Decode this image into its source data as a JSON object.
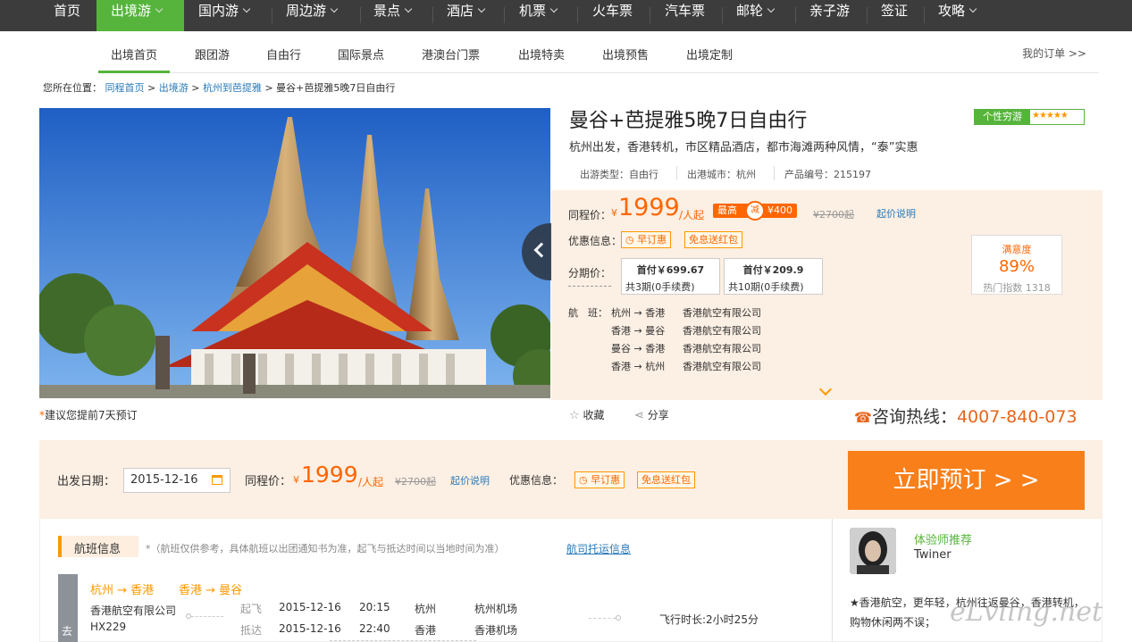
{
  "topnav": {
    "items": [
      {
        "label": "首页",
        "dropdown": false
      },
      {
        "label": "出境游",
        "dropdown": true
      },
      {
        "label": "国内游",
        "dropdown": true
      },
      {
        "label": "周边游",
        "dropdown": true
      },
      {
        "label": "景点",
        "dropdown": true
      },
      {
        "label": "酒店",
        "dropdown": true
      },
      {
        "label": "机票",
        "dropdown": true
      },
      {
        "label": "火车票",
        "dropdown": false
      },
      {
        "label": "汽车票",
        "dropdown": false
      },
      {
        "label": "邮轮",
        "dropdown": true
      },
      {
        "label": "亲子游",
        "dropdown": false
      },
      {
        "label": "签证",
        "dropdown": false
      },
      {
        "label": "攻略",
        "dropdown": true
      }
    ],
    "active": "出境游"
  },
  "subnav": {
    "items": [
      "出境首页",
      "跟团游",
      "自由行",
      "国际景点",
      "港澳台门票",
      "出境特卖",
      "出境预售",
      "出境定制"
    ],
    "my_order": "我的订单 >>"
  },
  "breadcrumb": {
    "prefix": "您所在位置：",
    "links": [
      "同程首页",
      "出境游",
      "杭州到芭提雅"
    ],
    "current": "曼谷+芭提雅5晚7日自由行",
    "sep": ">"
  },
  "advice": {
    "star": "*",
    "text": "建议您提前7天预订"
  },
  "product": {
    "title": "曼谷+芭提雅5晚7日自由行",
    "tag": "个性穷游",
    "stars": "★★★★★",
    "subtitle": "杭州出发，香港转机，市区精品酒店，都市海滩两种风情，“泰”实惠",
    "meta": [
      "出游类型：自由行",
      "出港城市：杭州",
      "产品编号：215197"
    ]
  },
  "pricebox": {
    "price_label": "同程价：",
    "currency": "¥",
    "price": "1999",
    "unit": "/人起",
    "max_label": "最高",
    "jian": "减",
    "max_value": "¥400",
    "original": "¥2700起",
    "explain": "起价说明",
    "promo_label": "优惠信息：",
    "promos": [
      "早订惠",
      "免息送红包"
    ],
    "installment_label": "分期价：",
    "installments": [
      {
        "first": "首付￥699.67",
        "detail": "共3期(0手续费)"
      },
      {
        "first": "首付￥209.9",
        "detail": "共10期(0手续费)"
      }
    ],
    "satisfaction": {
      "title": "满意度",
      "value": "89%",
      "hot": "热门指数 1318"
    },
    "flight_label": "航　班：",
    "flights": [
      {
        "route": "杭州 → 香港",
        "airline": "香港航空有限公司"
      },
      {
        "route": "香港 → 曼谷",
        "airline": "香港航空有限公司"
      },
      {
        "route": "曼谷 → 香港",
        "airline": "香港航空有限公司"
      },
      {
        "route": "香港 → 杭州",
        "airline": "香港航空有限公司"
      }
    ]
  },
  "actions": {
    "favorite": "收藏",
    "share": "分享"
  },
  "hotline": {
    "label": "咨询热线：",
    "number": "4007-840-073"
  },
  "bookbar": {
    "date_label": "出发日期：",
    "date": "2015-12-16",
    "price_label": "同程价：",
    "currency": "¥",
    "price": "1999",
    "unit": "/人起",
    "original": "¥2700起",
    "explain": "起价说明",
    "promo_label": "优惠信息：",
    "promos": [
      "早订惠",
      "免息送红包"
    ],
    "book_button": "立即预订 > >"
  },
  "flight_section": {
    "title": "航班信息",
    "note": "*（航班仅供参考，具体航班以出团通知书为准，起飞与抵达时间以当地时间为准）",
    "link": "航司托运信息",
    "direction": "去",
    "route1": "杭州 → 香港",
    "route2": "香港 → 曼谷",
    "airline": "香港航空有限公司",
    "flight_no": "HX229",
    "depart": {
      "label": "起飞",
      "date": "2015-12-16",
      "time": "20:15",
      "city": "杭州",
      "airport": "杭州机场"
    },
    "arrive": {
      "label": "抵达",
      "date": "2015-12-16",
      "time": "22:40",
      "city": "香港",
      "airport": "香港机场"
    },
    "duration": "飞行时长:2小时25分"
  },
  "recommend": {
    "title": "体验师推荐",
    "name": "Twiner",
    "text": "★香港航空，更年轻，杭州往返曼谷，香港转机，购物休闲两不误；"
  },
  "watermark": "eLvling.net",
  "colors": {
    "brand_green": "#56b43c",
    "accent_orange": "#f87f1a",
    "link_blue": "#2a7ab8"
  }
}
